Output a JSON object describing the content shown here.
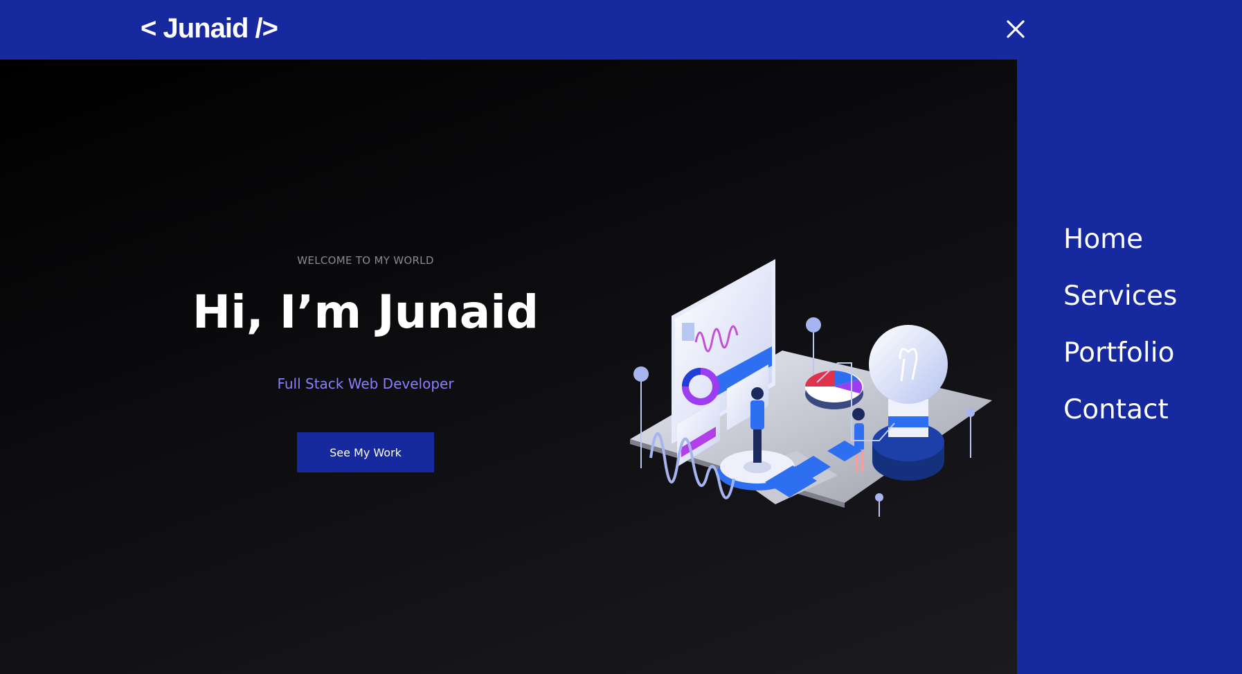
{
  "header": {
    "logo": "< Junaid />",
    "close_icon": "close-icon"
  },
  "hero": {
    "welcome": "WELCOME TO MY WORLD",
    "headline": "Hi, I’m Junaid",
    "role": "Full Stack Web Developer",
    "cta_label": "See My Work",
    "illustration": "isometric-data-analytics-illustration"
  },
  "nav": {
    "items": [
      {
        "label": "Home"
      },
      {
        "label": "Services"
      },
      {
        "label": "Portfolio"
      },
      {
        "label": "Contact"
      }
    ]
  },
  "colors": {
    "brand": "#16299e",
    "accent_text": "#8b7fff",
    "background_dark": "#0d0d10",
    "text_light": "#ffffff"
  }
}
